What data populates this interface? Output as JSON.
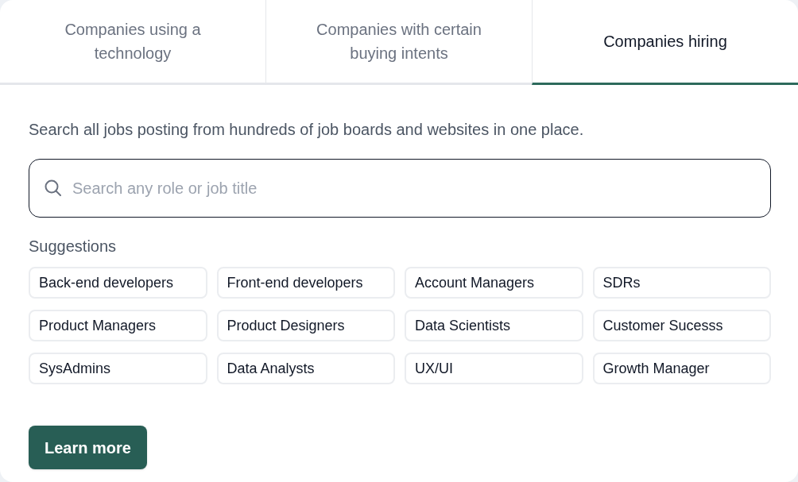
{
  "tabs": [
    {
      "label": "Companies using a technology",
      "selected": false
    },
    {
      "label": "Companies with certain buying intents",
      "selected": false
    },
    {
      "label": "Companies hiring",
      "selected": true
    }
  ],
  "description": "Search all jobs posting from hundreds of job boards and websites in one place.",
  "search": {
    "placeholder": "Search any role or job title"
  },
  "suggestions": {
    "label": "Suggestions",
    "items": [
      "Back-end developers",
      "Front-end developers",
      "Account Managers",
      "SDRs",
      "Product Managers",
      "Product Designers",
      "Data Scientists",
      "Customer Sucesss",
      "SysAdmins",
      "Data Analysts",
      "UX/UI",
      "Growth Manager"
    ]
  },
  "buttons": [
    "Learn more"
  ]
}
